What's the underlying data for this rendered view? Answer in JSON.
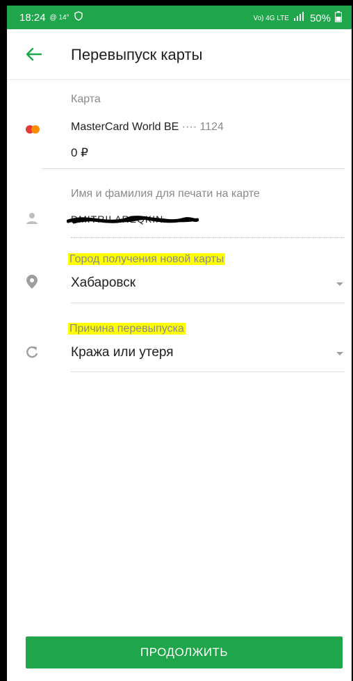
{
  "status_bar": {
    "time": "18:24",
    "temp": "@ 14°",
    "battery": "50%",
    "net": "Vo) 4G LTE"
  },
  "header": {
    "title": "Перевыпуск карты"
  },
  "card": {
    "label": "Карта",
    "name": "MasterCard World BE",
    "mask": "···· 1124",
    "balance": "0 ₽"
  },
  "name_field": {
    "label": "Имя и фамилия для печати на карте",
    "value": "DMITRII AREQKIN"
  },
  "city_field": {
    "label": "Город получения новой карты",
    "value": "Хабаровск"
  },
  "reason_field": {
    "label": "Причина перевыпуска",
    "value": "Кража или утеря"
  },
  "continue_button": {
    "label": "ПРОДОЛЖИТЬ"
  },
  "colors": {
    "brand": "#20a64a",
    "highlight": "#ffff00"
  }
}
